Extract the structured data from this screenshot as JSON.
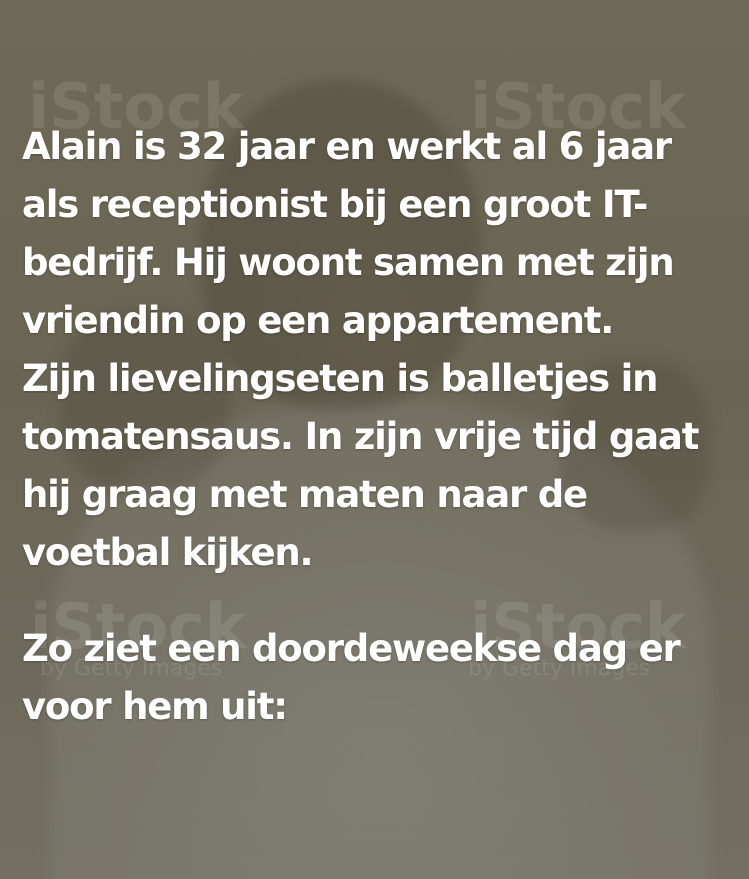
{
  "watermark": {
    "logo": "iStock",
    "sub": "by Getty Images"
  },
  "intro_lines": [
    "Alain is 32 jaar en werkt al 6 jaar",
    "als receptionist bij een groot IT-",
    "bedrijf. Hij woont samen met zijn",
    "vriendin op een appartement.",
    "Zijn lievelingseten is balletjes in",
    "tomatensaus. In zijn vrije tijd gaat",
    "hij graag met maten naar de",
    "voetbal kijken."
  ],
  "outro_lines": [
    "Zo ziet een doordeweekse dag er",
    "voor hem uit:"
  ],
  "colors": {
    "background": "#6b6553",
    "text": "#ffffff"
  }
}
